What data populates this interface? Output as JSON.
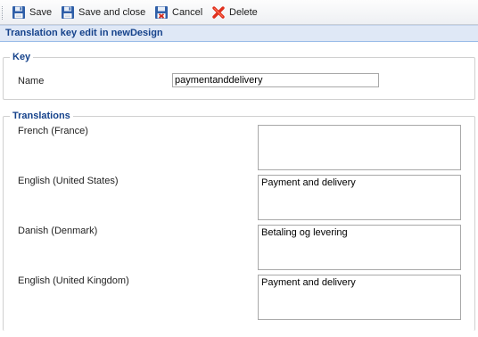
{
  "toolbar": {
    "save_label": "Save",
    "save_close_label": "Save and close",
    "cancel_label": "Cancel",
    "delete_label": "Delete"
  },
  "header": {
    "title": "Translation key edit in newDesign"
  },
  "key_section": {
    "legend": "Key",
    "name_label": "Name",
    "name_value": "paymentanddelivery"
  },
  "translations_section": {
    "legend": "Translations",
    "items": [
      {
        "language": "French (France)",
        "value": ""
      },
      {
        "language": "English (United States)",
        "value": "Payment and delivery"
      },
      {
        "language": "Danish (Denmark)",
        "value": "Betaling og levering"
      },
      {
        "language": "English (United Kingdom)",
        "value": "Payment and delivery"
      }
    ]
  },
  "colors": {
    "header_text": "#15428b",
    "header_bg": "#dfe8f6",
    "delete_icon": "#e0301e",
    "save_icon": "#2f5fa8"
  },
  "icons": {
    "save": "floppy-disk-icon",
    "save_close": "floppy-disk-icon",
    "cancel": "floppy-cancel-icon",
    "delete": "red-x-icon"
  }
}
